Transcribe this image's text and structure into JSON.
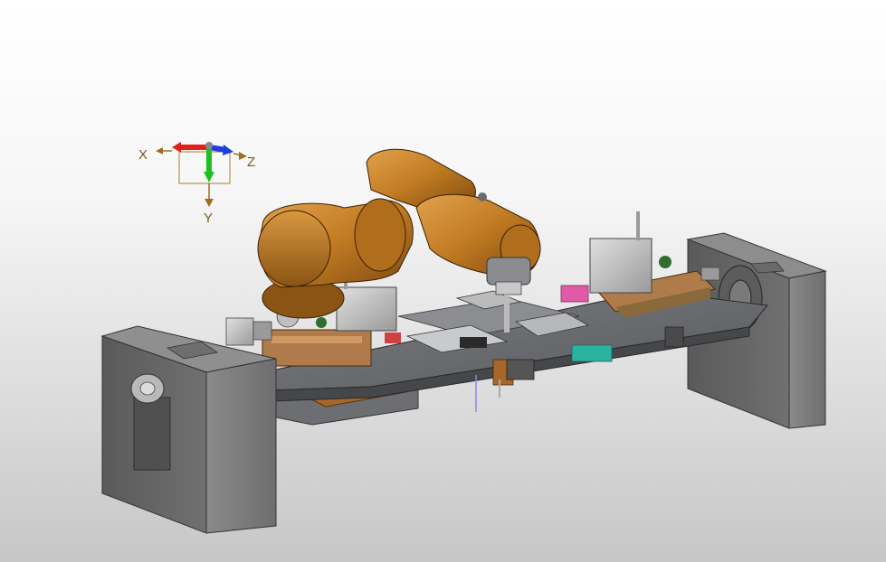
{
  "viewport": {
    "background_top": "#ffffff",
    "background_bottom": "#c6c6c6"
  },
  "triad": {
    "x_label": "X",
    "y_label": "Y",
    "z_label": "Z",
    "x_color": "#e0201b",
    "y_color": "#1fbf1f",
    "z_color": "#1f3fdf",
    "label_color": "#7a5a17"
  },
  "model": {
    "robot_color": "#c07a22",
    "frame_color": "#6b6b6b",
    "plate_color": "#5e6063",
    "accent_colors": [
      "#e05aa8",
      "#2bb2a0",
      "#b07b4a"
    ]
  }
}
